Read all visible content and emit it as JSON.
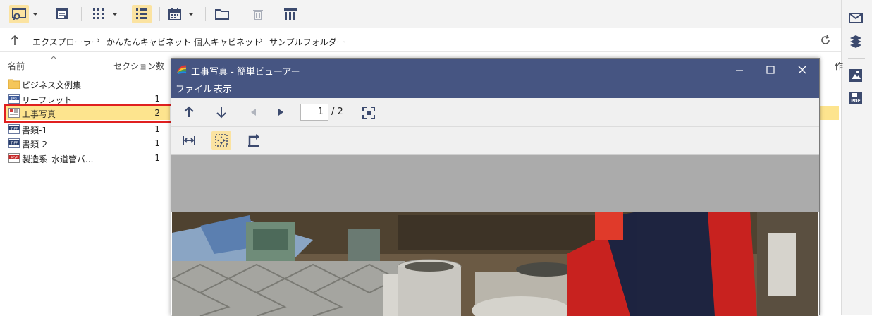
{
  "breadcrumb": [
    "エクスプローラー",
    "かんたんキャビネット",
    "個人キャビネット",
    "サンプルフォルダー"
  ],
  "columns": {
    "name": "名前",
    "sections": "セクション数",
    "trailing": "作"
  },
  "files": [
    {
      "name": "ビジネス文例集",
      "count": "",
      "type": "folder-icon"
    },
    {
      "name": "リーフレット",
      "count": "1",
      "type": "jpg-icon"
    },
    {
      "name": "工事写真",
      "count": "2",
      "type": "image-doc-icon",
      "selected": true
    },
    {
      "name": "書類-1",
      "count": "1",
      "type": "tiff-icon"
    },
    {
      "name": "書類-2",
      "count": "1",
      "type": "tiff-icon"
    },
    {
      "name": "製造系_水道管パ...",
      "count": "1",
      "type": "pdf-icon"
    }
  ],
  "viewer": {
    "title": "工事写真 - 簡単ビューアー",
    "menu": [
      "ファイル",
      "表示"
    ],
    "page_current": "1",
    "page_total": "/ 2",
    "fit_mode": "fit-page"
  },
  "colors": {
    "accent_active": "#fbe3a1",
    "selection": "#fde48e",
    "highlight_border": "#e02020",
    "viewer_titlebar": "#465582"
  }
}
